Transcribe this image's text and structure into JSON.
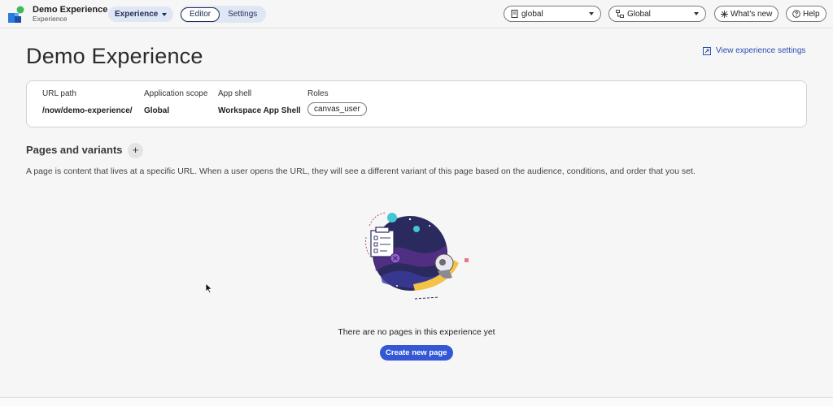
{
  "app": {
    "title": "Demo Experience",
    "subtitle": "Experience"
  },
  "topbar": {
    "experience_dropdown": "Experience",
    "tabs": [
      {
        "label": "Editor",
        "active": true
      },
      {
        "label": "Settings",
        "active": false
      }
    ],
    "scope_select": "global",
    "domain_select": "Global",
    "whats_new": "What's new",
    "help": "Help"
  },
  "main": {
    "title": "Demo Experience",
    "view_settings_link": "View experience settings",
    "info": {
      "url_path_label": "URL path",
      "url_path_value": "/now/demo-experience/",
      "app_scope_label": "Application scope",
      "app_scope_value": "Global",
      "app_shell_label": "App shell",
      "app_shell_value": "Workspace App Shell",
      "roles_label": "Roles",
      "roles": [
        "canvas_user"
      ]
    },
    "pages_section_title": "Pages and variants",
    "pages_section_desc": "A page is content that lives at a specific URL. When a user opens the URL, they will see a different variant of this page based on the audience, conditions, and order that you set.",
    "empty_message": "There are no pages in this experience yet",
    "create_button": "Create new page"
  },
  "colors": {
    "accent": "#3457d5",
    "link": "#2b50b3",
    "pill_bg": "#dfe6f4",
    "illus_dark": "#2a2a5e",
    "illus_yellow": "#f4c247",
    "illus_cyan": "#43c6d6",
    "illus_purple": "#9b5bd4"
  }
}
